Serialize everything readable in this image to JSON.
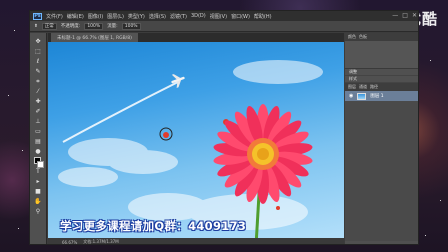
{
  "watermark": {
    "text": "优酷"
  },
  "app": {
    "logo": "Ps",
    "menu": [
      "文件(F)",
      "编辑(E)",
      "图像(I)",
      "图层(L)",
      "类型(Y)",
      "选择(S)",
      "滤镜(T)",
      "3D(D)",
      "视图(V)",
      "窗口(W)",
      "帮助(H)"
    ],
    "window_controls": [
      "—",
      "□",
      "✕"
    ]
  },
  "options_bar": {
    "fields": [
      "正常",
      "不透明度:",
      "100%",
      "流量:",
      "100%"
    ]
  },
  "document_tab": {
    "label": "未标题-1 @ 66.7% (图层 1, RGB/8)"
  },
  "status_bar": {
    "zoom": "66.67%",
    "info": "文档:1.37M/1.37M"
  },
  "panels": {
    "tabs": [
      "颜色",
      "色板"
    ],
    "rows": [
      "调整",
      "样式"
    ],
    "layer_tabs": [
      "图层",
      "通道",
      "路径"
    ],
    "layer_name": "图层 1"
  },
  "caption": {
    "text": "学习更多课程请加Q群：4409173"
  },
  "colors": {
    "sky_top": "#1d86d6",
    "sky_bottom": "#b8e2fb",
    "flower_petal": "#f0305a",
    "flower_center": "#f5c22a",
    "caption_outline": "#1d3da0"
  },
  "icons": {
    "tools": [
      "move-icon",
      "marquee-icon",
      "lasso-icon",
      "quick-select-icon",
      "crop-icon",
      "eyedropper-icon",
      "healing-brush-icon",
      "brush-icon",
      "clone-stamp-icon",
      "history-brush-icon",
      "eraser-icon",
      "gradient-icon",
      "blur-icon",
      "dodge-icon",
      "pen-icon",
      "type-icon",
      "path-select-icon",
      "shape-icon",
      "hand-icon",
      "zoom-icon"
    ]
  }
}
